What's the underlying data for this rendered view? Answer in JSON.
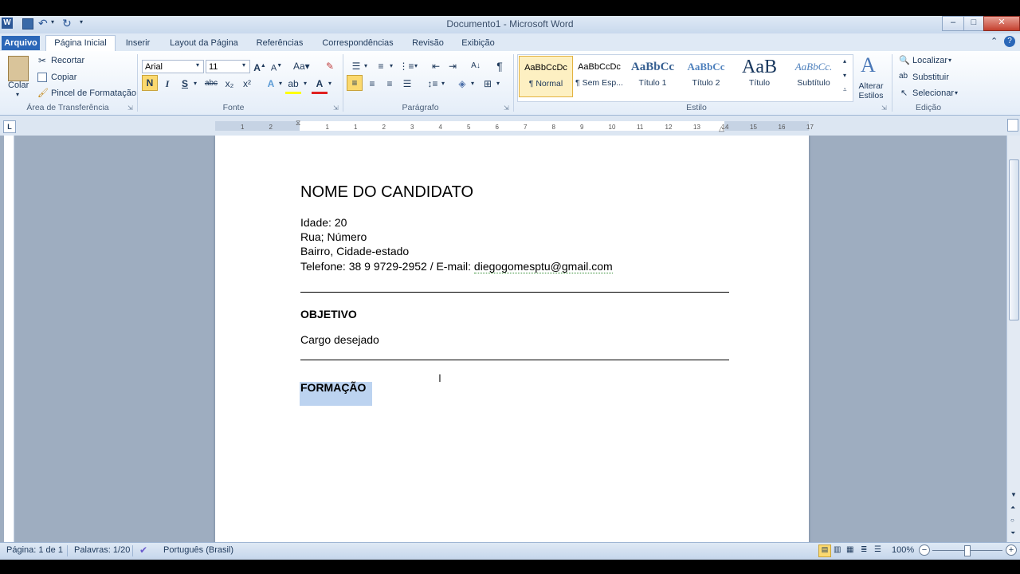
{
  "window": {
    "title": "Documento1 - Microsoft Word",
    "controls": [
      "–",
      "□",
      "✕"
    ]
  },
  "tabs": [
    {
      "label": "Arquivo"
    },
    {
      "label": "Página Inicial"
    },
    {
      "label": "Inserir"
    },
    {
      "label": "Layout da Página"
    },
    {
      "label": "Referências"
    },
    {
      "label": "Correspondências"
    },
    {
      "label": "Revisão"
    },
    {
      "label": "Exibição"
    }
  ],
  "clipboard": {
    "paste": "Colar",
    "cut": "Recortar",
    "copy": "Copiar",
    "format_painter": "Pincel de Formatação",
    "group": "Área de Transferência"
  },
  "font": {
    "family": "Arial",
    "size": "11",
    "bold": "N",
    "italic": "I",
    "underline": "S",
    "strike": "abc",
    "subscript": "x₂",
    "superscript": "x²",
    "group": "Fonte"
  },
  "paragraph": {
    "group": "Parágrafo",
    "pilcrow": "¶"
  },
  "styles": {
    "group": "Estilo",
    "items": [
      {
        "preview": "AaBbCcDc",
        "name": "¶ Normal"
      },
      {
        "preview": "AaBbCcDc",
        "name": "¶ Sem Esp..."
      },
      {
        "preview": "AaBbCc",
        "name": "Título 1"
      },
      {
        "preview": "AaBbCc",
        "name": "Título 2"
      },
      {
        "preview": "AaB",
        "name": "Título"
      },
      {
        "preview": "AaBbCc.",
        "name": "Subtítulo"
      }
    ],
    "change": "Alterar Estilos"
  },
  "editing": {
    "group": "Edição",
    "find": "Localizar",
    "replace": "Substituir",
    "select": "Selecionar"
  },
  "ruler": {
    "ticks": [
      "1",
      "2",
      "1",
      "1",
      "2",
      "3",
      "4",
      "5",
      "6",
      "7",
      "8",
      "9",
      "10",
      "11",
      "12",
      "13",
      "14",
      "15",
      "16",
      "17"
    ]
  },
  "document": {
    "name_heading": "NOME DO CANDIDATO",
    "age": "Idade: 20",
    "street": "Rua; Número",
    "district": "Bairro, Cidade-estado",
    "phone_prefix": "Telefone: 38 9 9729-2952 / E-mail: ",
    "email": "diegogomesptu@gmail.com",
    "objective_heading": "OBJETIVO",
    "objective_text": "Cargo desejado",
    "education_heading": "FORMAÇÃO"
  },
  "status": {
    "page": "Página: 1 de 1",
    "words": "Palavras: 1/20",
    "language": "Português (Brasil)",
    "zoom": "100%"
  }
}
